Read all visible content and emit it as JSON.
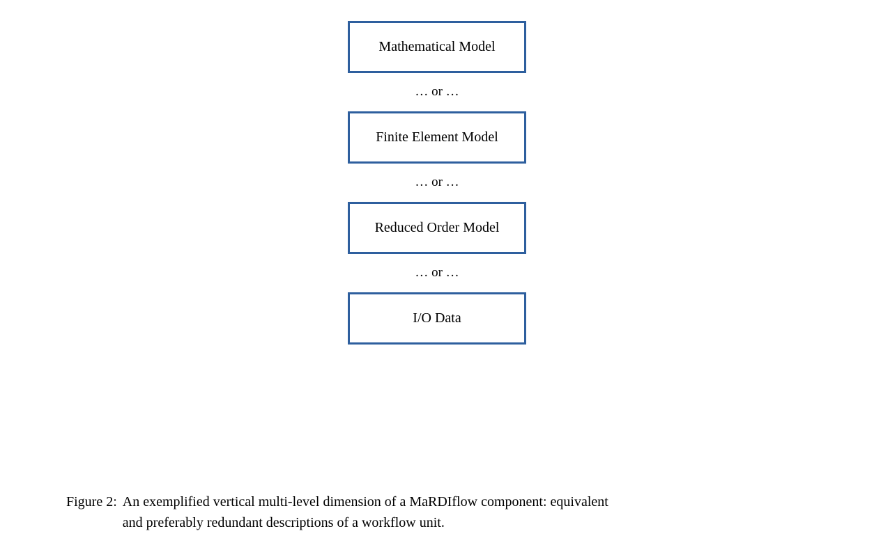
{
  "diagram": {
    "boxes": [
      {
        "label": "Mathematical Model"
      },
      {
        "label": "Finite Element Model"
      },
      {
        "label": "Reduced Order Model"
      },
      {
        "label": "I/O Data"
      }
    ],
    "connector": "… or …"
  },
  "caption": {
    "label": "Figure 2:",
    "line1": "An exemplified vertical multi-level dimension of a MaRDIflow component: equivalent",
    "line2": "and preferably redundant descriptions of a workflow unit."
  }
}
